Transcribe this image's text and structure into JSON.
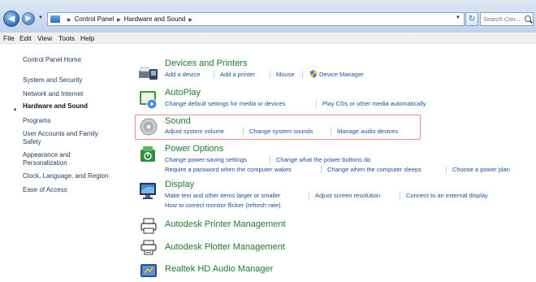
{
  "address_bar": {
    "breadcrumbs": [
      "Control Panel",
      "Hardware and Sound"
    ],
    "search_placeholder": "Search Con..."
  },
  "menu": [
    "File",
    "Edit",
    "View",
    "Tools",
    "Help"
  ],
  "left_pane": {
    "items": [
      "Control Panel Home",
      "System and Security",
      "Network and Internet",
      "Hardware and Sound",
      "Programs",
      "User Accounts and Family",
      "Safety",
      "Appearance and",
      "Personalization",
      "Clock, Language, and Region",
      "Ease of Access"
    ],
    "current": "Hardware and Sound",
    "bullet": "•"
  },
  "categories": {
    "devices": {
      "title": "Devices and Printers",
      "links": [
        "Add a device",
        "Add a printer",
        "Mouse",
        "Device Manager"
      ]
    },
    "autoplay": {
      "title": "AutoPlay",
      "links": [
        "Change default settings for media or devices",
        "Play CDs or other media automatically"
      ]
    },
    "sound": {
      "title": "Sound",
      "links": [
        "Adjust system volume",
        "Change system sounds",
        "Manage audio devices"
      ]
    },
    "power": {
      "title": "Power Options",
      "links": [
        "Change power-saving settings",
        "Change what the power buttons do",
        "Require a password when the computer wakes",
        "Change when the computer sleeps",
        "Choose a power plan"
      ]
    },
    "display": {
      "title": "Display",
      "links": [
        "Make text and other items larger or smaller",
        "Adjust screen resolution",
        "Connect to an external display",
        "How to correct monitor flicker (refresh rate)"
      ]
    },
    "autodesk_printer": {
      "title": "Autodesk Printer Management"
    },
    "autodesk_plotter": {
      "title": "Autodesk Plotter Management"
    },
    "realtek": {
      "title": "Realtek HD Audio Manager"
    }
  },
  "highlight_color": "#e88d8d",
  "title_color": "#1d7a2e",
  "link_color": "#1d4fa0"
}
